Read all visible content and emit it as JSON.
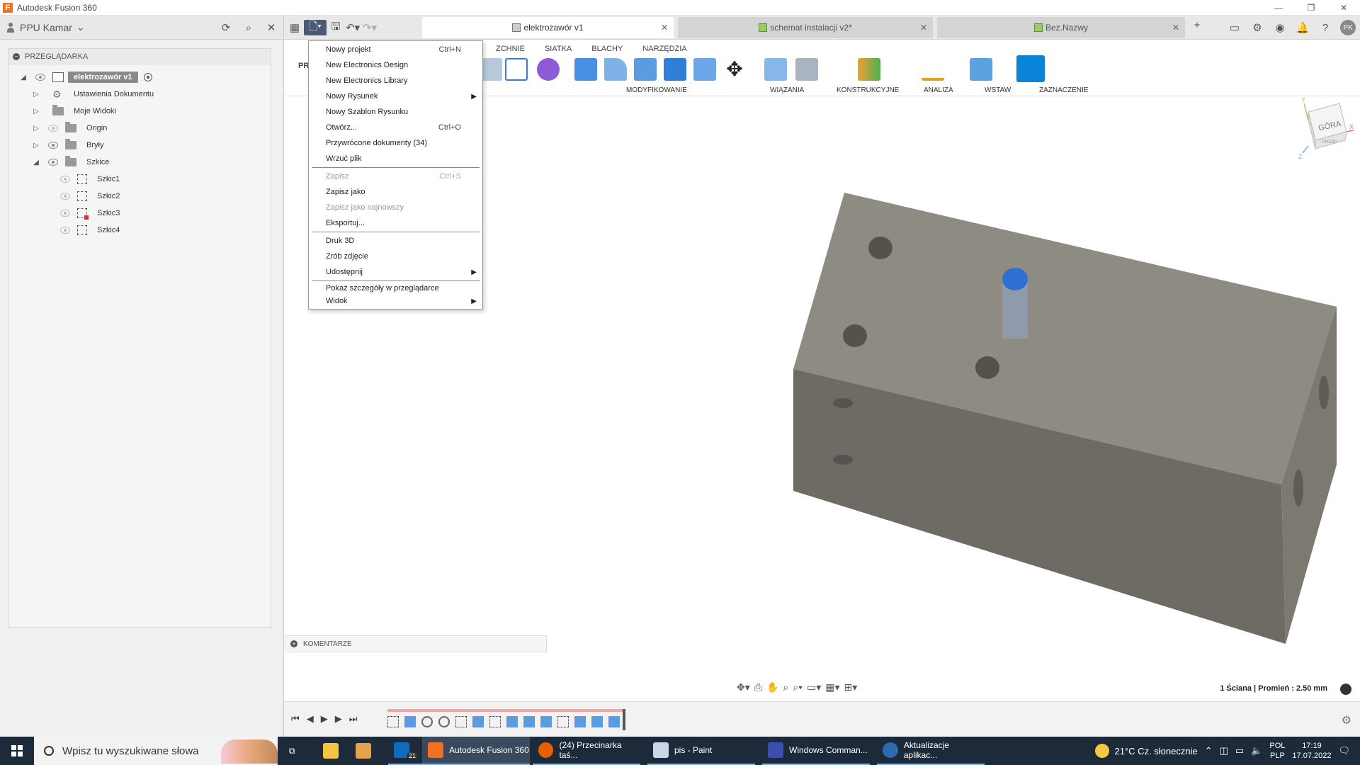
{
  "window": {
    "title": "Autodesk Fusion 360",
    "minimize": "—",
    "maximize": "❐",
    "close": "✕"
  },
  "user": {
    "name": "PPU Kamar"
  },
  "tabs": [
    {
      "label": "elektrozawór v1"
    },
    {
      "label": "schemat  instalacji v2*"
    },
    {
      "label": "Bez.Nazwy"
    }
  ],
  "avatar": "PK",
  "browser": {
    "title": "PRZEGLĄDARKA",
    "root": "elektrozawór v1",
    "items": [
      {
        "label": "Ustawienia Dokumentu"
      },
      {
        "label": "Moje Widoki"
      },
      {
        "label": "Origin"
      },
      {
        "label": "Bryły"
      },
      {
        "label": "Szkice"
      }
    ],
    "sketches": [
      "Szkic1",
      "Szkic2",
      "Szkic3",
      "Szkic4"
    ]
  },
  "toolbar": {
    "workspace": "PR",
    "ribbon_tabs": [
      "ZCHNIE",
      "SIATKA",
      "BLACHY",
      "NARZĘDZIA"
    ],
    "groups": [
      {
        "label": "MODYFIKOWANIE"
      },
      {
        "label": "WIĄZANIA"
      },
      {
        "label": "KONSTRUKCYJNE"
      },
      {
        "label": "ANALIZA"
      },
      {
        "label": "WSTAW"
      },
      {
        "label": "ZAZNACZENIE"
      }
    ]
  },
  "file_menu": {
    "items": [
      {
        "label": "Nowy projekt",
        "shortcut": "Ctrl+N"
      },
      {
        "label": "New Electronics Design"
      },
      {
        "label": "New Electronics Library"
      },
      {
        "label": "Nowy Rysunek"
      },
      {
        "label": "Nowy Szablon Rysunku"
      },
      {
        "label": "Otwórz...",
        "shortcut": "Ctrl+O"
      },
      {
        "label": "Przywrócone dokumenty (34)"
      },
      {
        "label": "Wrzuć plik"
      },
      {
        "label": "Zapisz",
        "shortcut": "Ctrl+S"
      },
      {
        "label": "Zapisz jako"
      },
      {
        "label": "Zapisz jako najnowszy"
      },
      {
        "label": "Eksportuj..."
      },
      {
        "label": "Druk 3D"
      },
      {
        "label": "Zrób zdjęcie"
      },
      {
        "label": "Udostępnij"
      },
      {
        "label": "Pokaż szczegóły w przeglądarce"
      },
      {
        "label": "Widok"
      }
    ]
  },
  "viewcube": {
    "face": "GÓRA",
    "front": "PRZÓD",
    "x": "X",
    "y": "Y",
    "z": "Z"
  },
  "comments": {
    "label": "KOMENTARZE"
  },
  "status": {
    "text": "1 Ściana | Promień : 2.50 mm"
  },
  "colors": {
    "model_face_top": "#8e8b83",
    "model_face_front": "#6e6b64",
    "highlight": "#2f6fd1",
    "accent": "#0696d7"
  },
  "taskbar": {
    "search_placeholder": "Wpisz tu wyszukiwane słowa",
    "badge": "21",
    "apps": [
      {
        "label": "Autodesk Fusion 360"
      },
      {
        "label": "(24) Przecinarka taś..."
      },
      {
        "label": "pis - Paint"
      },
      {
        "label": "Windows Comman..."
      },
      {
        "label": "Aktualizacje aplikac..."
      }
    ],
    "weather": "21°C  Cz. słonecznie",
    "lang_top": "POL",
    "lang_bottom": "PLP",
    "time": "17:19",
    "date": "17.07.2022"
  }
}
